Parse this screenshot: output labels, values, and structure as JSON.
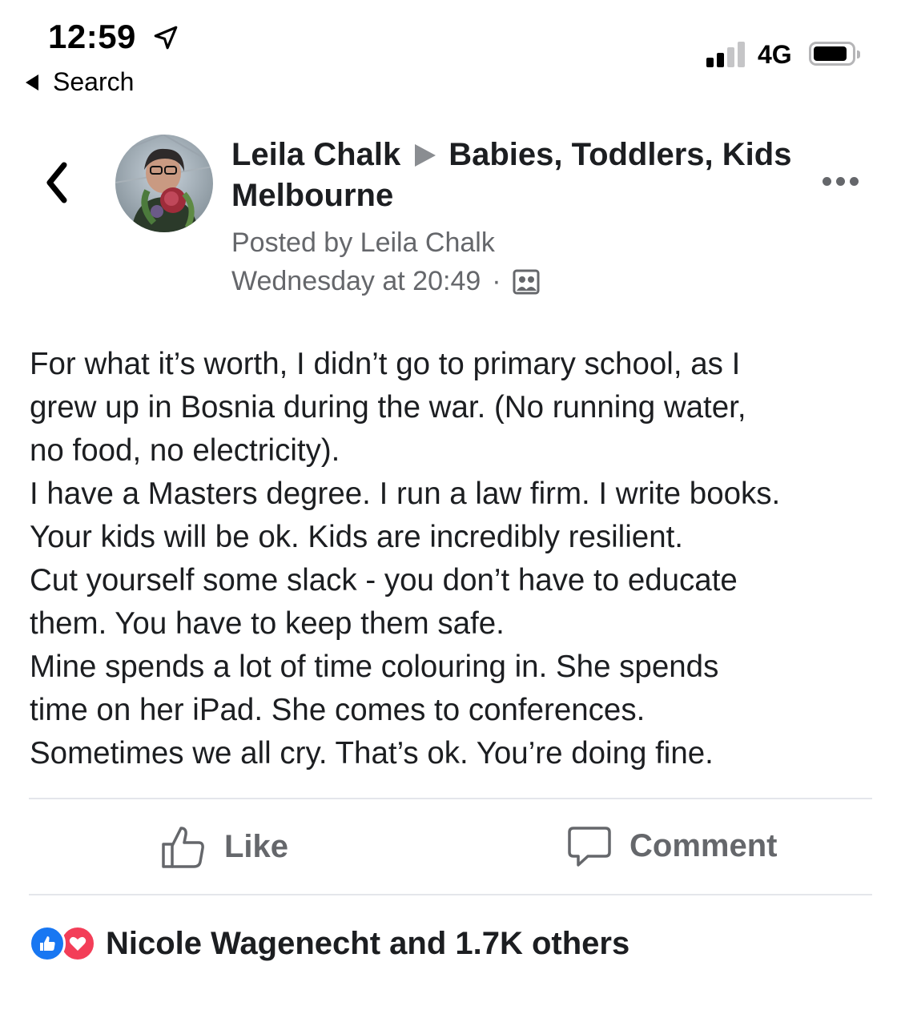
{
  "status_bar": {
    "time": "12:59",
    "back_app": "Search",
    "network": "4G",
    "signal_bars_active": 2,
    "signal_bars_total": 4
  },
  "post": {
    "author": "Leila Chalk",
    "group": "Babies, Toddlers, Kids Melbourne",
    "posted_by": "Posted by Leila Chalk",
    "timestamp": "Wednesday at 20:49",
    "separator": "·",
    "body_lines": [
      "For what it’s worth, I didn’t go to primary school, as I",
      "grew up in Bosnia during the war. (No running water,",
      "no food, no electricity).",
      "I have a Masters degree. I run a law firm. I write books.",
      "Your kids will be ok. Kids are incredibly resilient.",
      "Cut yourself some slack - you don’t have to educate",
      "them. You have to keep them safe.",
      "Mine spends a lot of time colouring in. She spends",
      "time on her iPad. She comes to conferences.",
      "Sometimes we all cry. That’s ok. You’re doing fine."
    ]
  },
  "actions": {
    "like_label": "Like",
    "comment_label": "Comment"
  },
  "reactions": {
    "summary": "Nicole Wagenecht and 1.7K others",
    "types": [
      "like-icon",
      "love-icon"
    ]
  },
  "colors": {
    "text_primary": "#1c1e21",
    "text_secondary": "#65676b",
    "like_blue": "#1877f2",
    "love_red": "#f33e58",
    "divider": "#e4e6eb"
  }
}
